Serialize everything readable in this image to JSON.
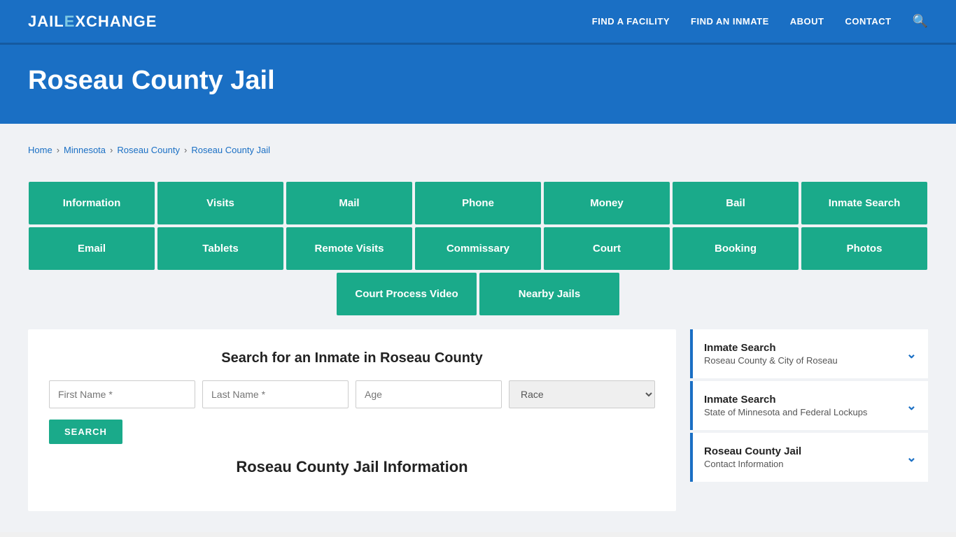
{
  "header": {
    "logo_jail": "JAIL",
    "logo_ex": "E",
    "logo_change": "XCHANGE",
    "nav": {
      "find_facility": "FIND A FACILITY",
      "find_inmate": "FIND AN INMATE",
      "about": "ABOUT",
      "contact": "CONTACT"
    }
  },
  "hero": {
    "title": "Roseau County Jail"
  },
  "breadcrumb": {
    "home": "Home",
    "state": "Minnesota",
    "county": "Roseau County",
    "jail": "Roseau County Jail"
  },
  "buttons": {
    "row1": [
      "Information",
      "Visits",
      "Mail",
      "Phone",
      "Money",
      "Bail",
      "Inmate Search"
    ],
    "row2": [
      "Email",
      "Tablets",
      "Remote Visits",
      "Commissary",
      "Court",
      "Booking",
      "Photos"
    ],
    "row3": [
      "Court Process Video",
      "Nearby Jails"
    ]
  },
  "search": {
    "title": "Search for an Inmate in Roseau County",
    "first_name_placeholder": "First Name *",
    "last_name_placeholder": "Last Name *",
    "age_placeholder": "Age",
    "race_placeholder": "Race",
    "button_label": "SEARCH"
  },
  "info_section": {
    "title": "Roseau County Jail Information"
  },
  "sidebar": {
    "items": [
      {
        "title": "Inmate Search",
        "subtitle": "Roseau County & City of Roseau"
      },
      {
        "title": "Inmate Search",
        "subtitle": "State of Minnesota and Federal Lockups"
      },
      {
        "title": "Roseau County Jail",
        "subtitle": "Contact Information"
      }
    ]
  }
}
